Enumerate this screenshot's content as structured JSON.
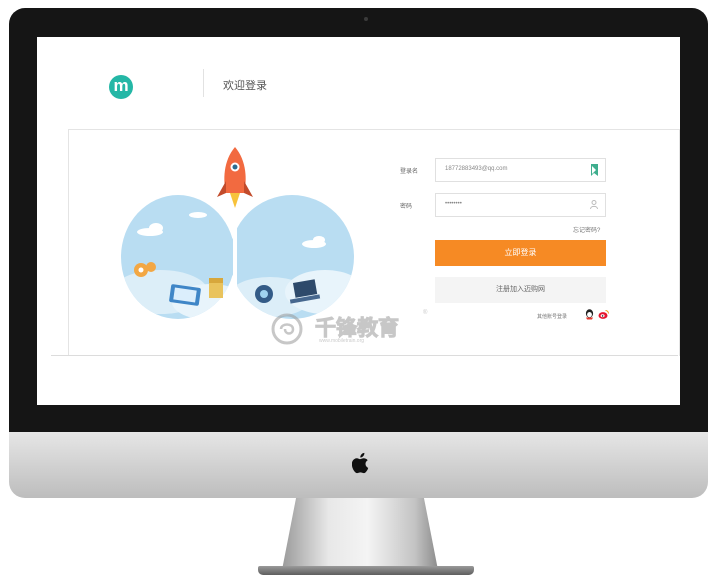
{
  "header": {
    "logo_letter": "m",
    "welcome_text": "欢迎登录"
  },
  "login_form": {
    "username_label": "登录名",
    "username_value": "18772883493@qq.com",
    "password_label": "密码",
    "password_value": "••••••••",
    "remember_label": "忘记密码?",
    "login_button_label": "立即登录",
    "register_button_label": "注册加入迈购网",
    "other_login_label": "其他账号登录"
  },
  "watermark": {
    "brand": "千锋教育",
    "url": "www.mobiletrain.org",
    "registered": "®"
  },
  "icons": [
    "apple-icon",
    "qq-icon",
    "weibo-icon",
    "user-icon",
    "rocket-icon",
    "verify-icon"
  ],
  "colors": {
    "accent_orange": "#f68a24",
    "logo_teal": "#24b7a6",
    "sky_blue": "#b9ddf2"
  }
}
